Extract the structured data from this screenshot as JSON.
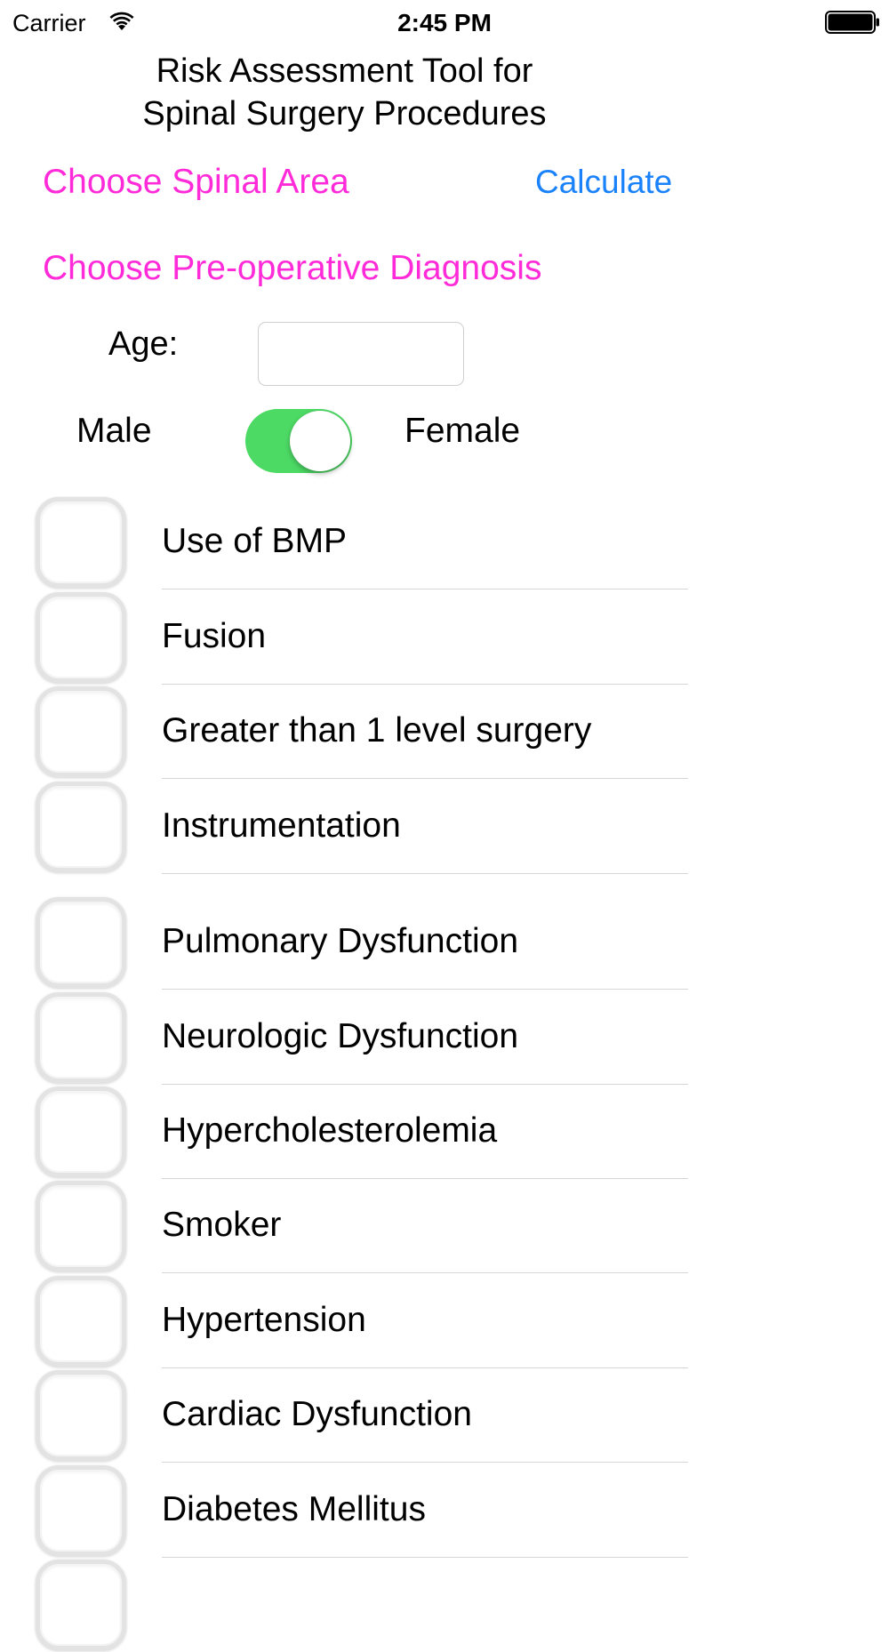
{
  "status_bar": {
    "carrier": "Carrier",
    "time": "2:45 PM",
    "wifi_icon": "wifi-icon",
    "battery_icon": "battery-icon"
  },
  "header": {
    "title_line1": "Risk Assessment Tool for",
    "title_line2": "Spinal Surgery Procedures"
  },
  "links": {
    "choose_spinal_area": "Choose Spinal Area",
    "calculate": "Calculate",
    "choose_diagnosis": "Choose Pre-operative Diagnosis"
  },
  "age": {
    "label": "Age:",
    "value": "",
    "placeholder": ""
  },
  "gender": {
    "male_label": "Male",
    "female_label": "Female",
    "toggle_on": true
  },
  "colors": {
    "link_magenta": "#ff2bd9",
    "link_blue": "#1a82fb",
    "toggle_green": "#4cd964"
  },
  "procedure_items": [
    {
      "label": "Use of BMP",
      "checked": false
    },
    {
      "label": "Fusion",
      "checked": false
    },
    {
      "label": "Greater than 1 level surgery",
      "checked": false
    },
    {
      "label": "Instrumentation",
      "checked": false
    }
  ],
  "condition_items": [
    {
      "label": "Pulmonary Dysfunction",
      "checked": false
    },
    {
      "label": "Neurologic Dysfunction",
      "checked": false
    },
    {
      "label": "Hypercholesterolemia",
      "checked": false
    },
    {
      "label": "Smoker",
      "checked": false
    },
    {
      "label": "Hypertension",
      "checked": false
    },
    {
      "label": "Cardiac Dysfunction",
      "checked": false
    },
    {
      "label": "Diabetes Mellitus",
      "checked": false
    },
    {
      "label": "",
      "checked": false
    }
  ]
}
